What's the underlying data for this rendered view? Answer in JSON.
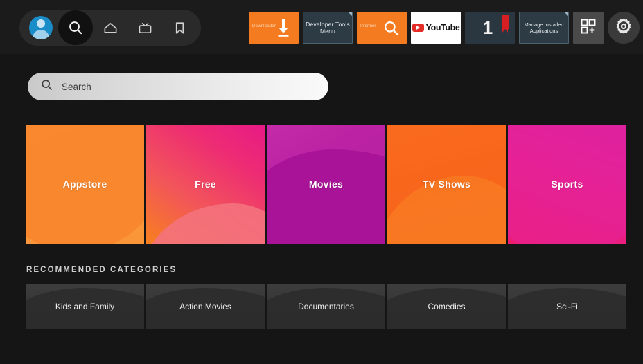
{
  "topbar": {
    "nav": [
      {
        "name": "profile",
        "label": "Profile",
        "icon": "avatar-icon",
        "selected": false
      },
      {
        "name": "search",
        "label": "Search",
        "icon": "search-icon",
        "selected": true
      },
      {
        "name": "home",
        "label": "Home",
        "icon": "home-icon",
        "selected": false
      },
      {
        "name": "live",
        "label": "Live TV",
        "icon": "tv-icon",
        "selected": false
      },
      {
        "name": "bookmark",
        "label": "Bookmarks",
        "icon": "bookmark-icon",
        "selected": false
      }
    ],
    "apps": [
      {
        "id": "downloader",
        "label": "Downloader",
        "icon": "download-arrow-icon"
      },
      {
        "id": "developer-tools",
        "label": "Developer Tools Menu",
        "icon": "corner-flag-icon"
      },
      {
        "id": "informer",
        "label": "Informer",
        "icon": "magnifier-icon"
      },
      {
        "id": "youtube",
        "label": "YouTube",
        "icon": "youtube-play-icon"
      },
      {
        "id": "app-one",
        "label": "1",
        "icon": "red-ribbon-icon"
      },
      {
        "id": "manage-installed",
        "label": "Manage Installed Applications",
        "icon": "corner-flag-icon"
      },
      {
        "id": "app-grid",
        "label": "",
        "icon": "grid-plus-icon"
      },
      {
        "id": "settings",
        "label": "",
        "icon": "gear-icon"
      }
    ]
  },
  "search": {
    "placeholder": "Search",
    "value": "",
    "icon": "search-icon"
  },
  "tiles": [
    {
      "label": "Appstore",
      "color": "#FA9842"
    },
    {
      "label": "Free",
      "color": "#ED2C73"
    },
    {
      "label": "Movies",
      "color": "#B21FA2"
    },
    {
      "label": "TV Shows",
      "color": "#F8651C"
    },
    {
      "label": "Sports",
      "color": "#E4208F"
    }
  ],
  "recommended": {
    "title": "RECOMMENDED CATEGORIES",
    "items": [
      {
        "label": "Kids and Family"
      },
      {
        "label": "Action Movies"
      },
      {
        "label": "Documentaries"
      },
      {
        "label": "Comedies"
      },
      {
        "label": "Sci-Fi"
      }
    ]
  },
  "colors": {
    "background": "#151515",
    "topbar": "#1b1b1b",
    "nav_pill": "#2a2a2a",
    "accent_orange": "#F47B20",
    "accent_magenta": "#ED2C73",
    "avatar_blue": "#1A8CC8",
    "ribbon_red": "#D61F22"
  }
}
